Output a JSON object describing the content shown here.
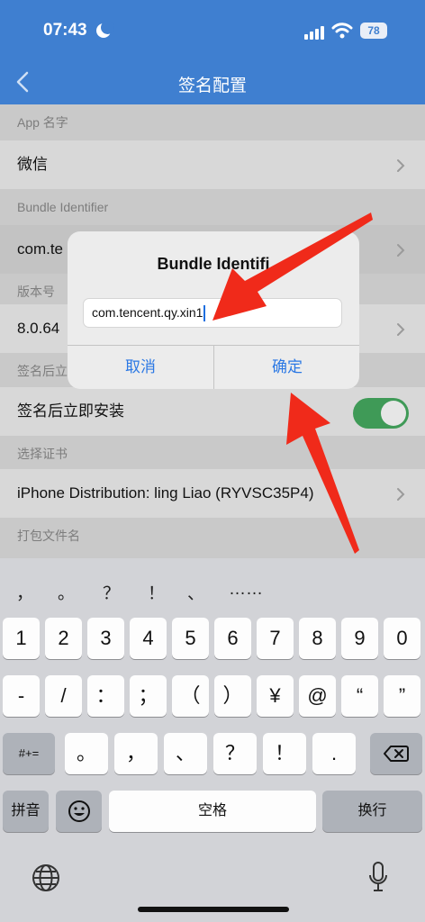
{
  "status_bar": {
    "time": "07:43",
    "battery": "78"
  },
  "nav": {
    "title": "签名配置"
  },
  "list": {
    "app_name_header": "App 名字",
    "app_name_value": "微信",
    "bundle_header": "Bundle Identifier",
    "bundle_value": "com.te",
    "version_header": "版本号",
    "version_value": "8.0.64",
    "install_header": "签名后立",
    "install_label": "签名后立即安装",
    "install_toggle_on": true,
    "cert_header": "选择证书",
    "cert_value": "iPhone Distribution: ling Liao (RYVSC35P4",
    "cert_value_tail": ")",
    "package_header": "打包文件名"
  },
  "dialog": {
    "title": "Bundle Identifi",
    "input_value": "com.tencent.qy.xin1",
    "cancel_label": "取消",
    "confirm_label": "确定"
  },
  "keyboard": {
    "suggestions": [
      "，",
      "。",
      "？",
      "！",
      "、",
      "……"
    ],
    "row1": [
      "1",
      "2",
      "3",
      "4",
      "5",
      "6",
      "7",
      "8",
      "9",
      "0"
    ],
    "row2": [
      "-",
      "/",
      "：",
      "；",
      "（",
      "）",
      "¥",
      "@",
      "“",
      "”"
    ],
    "row3_mode": "#+=",
    "row3": [
      "。",
      "，",
      "、",
      "？",
      "！",
      "."
    ],
    "pinyin_label": "拼音",
    "space_label": "空格",
    "return_label": "换行"
  },
  "colors": {
    "header": "#3f7fd0",
    "link": "#2b78e4",
    "arrow": "#f02a1a",
    "toggle": "#3f9a57"
  }
}
